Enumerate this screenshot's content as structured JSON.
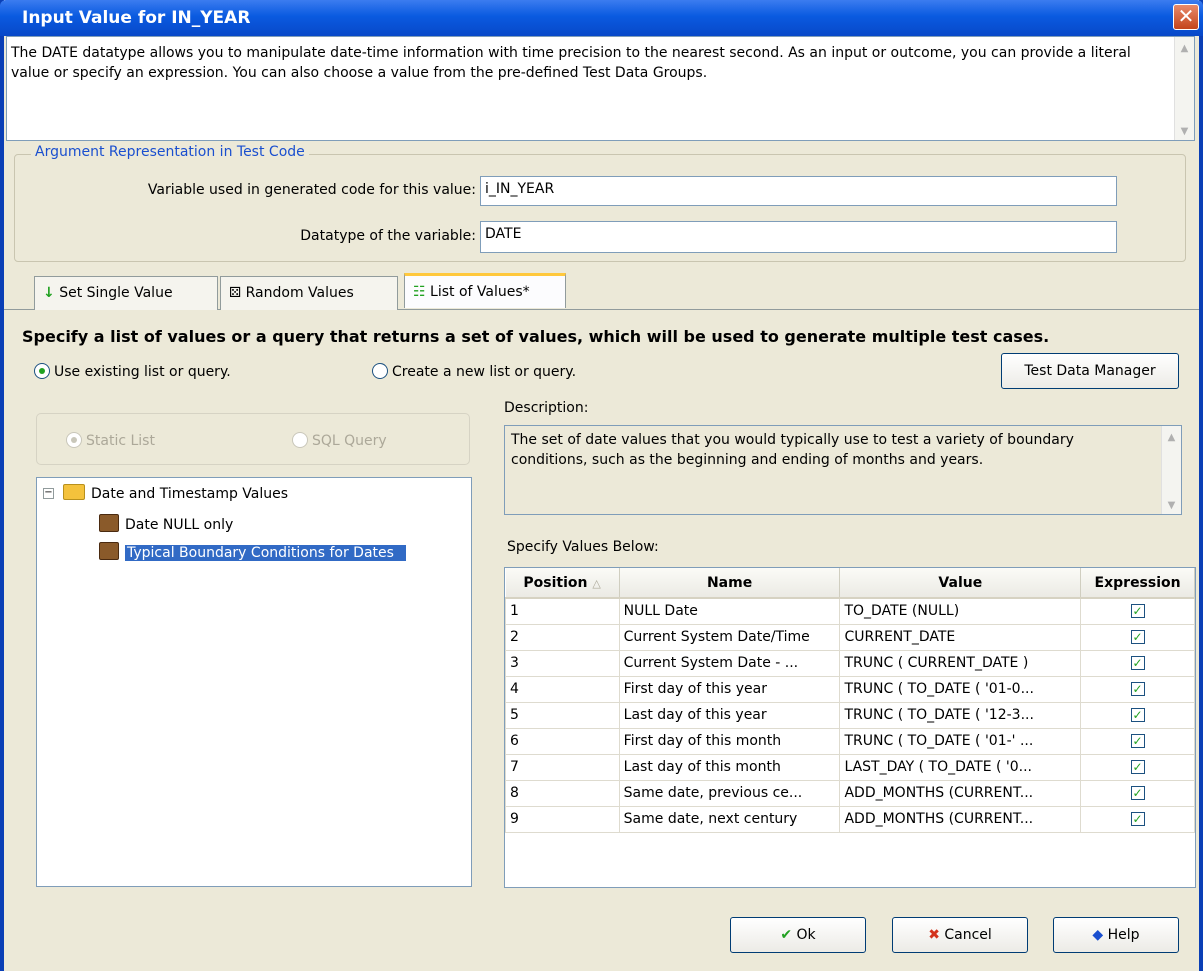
{
  "window": {
    "title": "Input Value for IN_YEAR"
  },
  "description": "The DATE datatype allows you to manipulate date-time information with time precision to the nearest second. As an input or outcome, you can provide a literal value or specify an expression. You can also choose a value from the pre-defined Test Data Groups.",
  "argument": {
    "legend": "Argument Representation in Test Code",
    "variable_label": "Variable used in generated code for this value:",
    "variable_value": "i_IN_YEAR",
    "datatype_label": "Datatype of the variable:",
    "datatype_value": "DATE"
  },
  "tabs": [
    {
      "label": "Set Single Value"
    },
    {
      "label": "Random Values"
    },
    {
      "label": "List of Values*",
      "active": true
    }
  ],
  "list_tab": {
    "heading": "Specify a list of values or a query that returns a set of values, which will be used to generate multiple test cases.",
    "radio_existing": "Use existing list or query.",
    "radio_new": "Create a new list or query.",
    "test_data_manager": "Test Data Manager",
    "radio_static": "Static List",
    "radio_sql": "SQL Query",
    "tree": {
      "root": "Date and Timestamp Values",
      "children": [
        "Date NULL only",
        "Typical Boundary Conditions for Dates"
      ]
    },
    "description_label": "Description:",
    "description_text": "The set of date values that you would typically use to test a variety of boundary conditions, such as the beginning and ending of months and years.",
    "specify_label": "Specify Values Below:",
    "columns": [
      "Position",
      "Name",
      "Value",
      "Expression"
    ],
    "rows": [
      {
        "position": "1",
        "name": "NULL Date",
        "value": "TO_DATE (NULL)",
        "expression": true
      },
      {
        "position": "2",
        "name": "Current System Date/Time",
        "value": "CURRENT_DATE",
        "expression": true
      },
      {
        "position": "3",
        "name": "Current System Date - ...",
        "value": "TRUNC ( CURRENT_DATE )",
        "expression": true
      },
      {
        "position": "4",
        "name": "First day of this year",
        "value": "TRUNC ( TO_DATE ( '01-0...",
        "expression": true
      },
      {
        "position": "5",
        "name": "Last day of this year",
        "value": "TRUNC ( TO_DATE ( '12-3...",
        "expression": true
      },
      {
        "position": "6",
        "name": "First day of this month",
        "value": "TRUNC ( TO_DATE ( '01-' ...",
        "expression": true
      },
      {
        "position": "7",
        "name": "Last day of this month",
        "value": "LAST_DAY ( TO_DATE ( '0...",
        "expression": true
      },
      {
        "position": "8",
        "name": "Same date, previous ce...",
        "value": "ADD_MONTHS (CURRENT...",
        "expression": true
      },
      {
        "position": "9",
        "name": "Same date, next century",
        "value": "ADD_MONTHS (CURRENT...",
        "expression": true
      }
    ]
  },
  "buttons": {
    "ok": "Ok",
    "cancel": "Cancel",
    "help": "Help"
  }
}
